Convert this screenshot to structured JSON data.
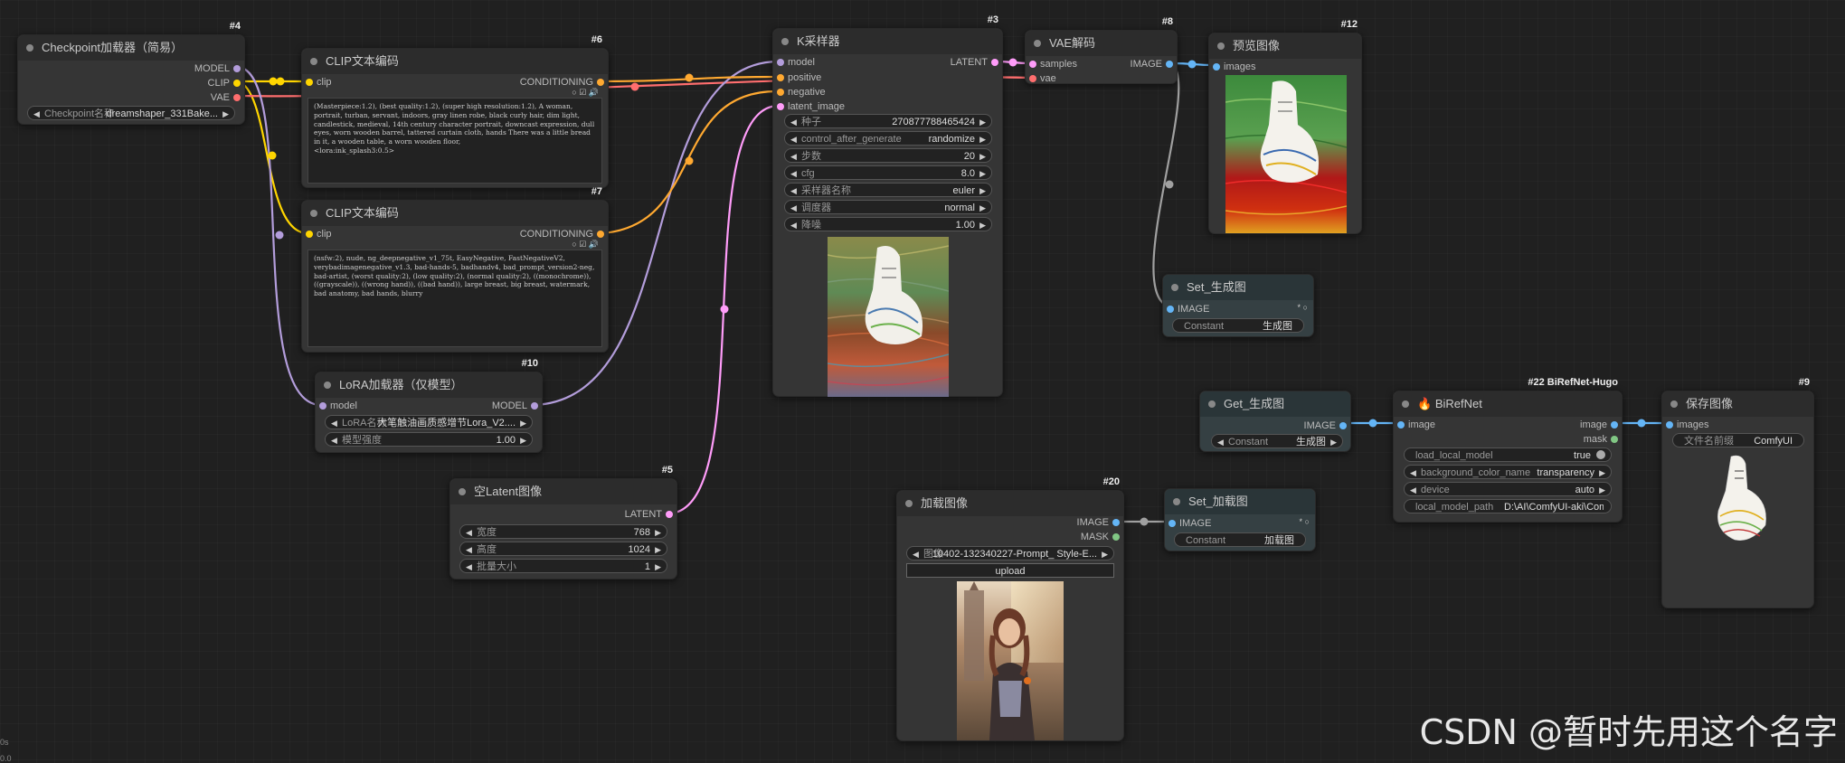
{
  "nodes": {
    "n4": {
      "id": "#4",
      "title": "Checkpoint加载器（简易）",
      "outputs": [
        "MODEL",
        "CLIP",
        "VAE"
      ],
      "widget_label": "Checkpoint名称",
      "widget_value": "dreamshaper_331Bake..."
    },
    "n6": {
      "id": "#6",
      "title": "CLIP文本编码",
      "input": "clip",
      "output": "CONDITIONING",
      "text": "(Masterpiece:1.2), (best quality:1.2), (super high resolution:1.2), A woman, portrait, turban, servant, indoors, gray linen robe, black curly hair, dim light, candlestick, medieval, 14th century character portrait, downcast expression, dull eyes, worn wooden barrel, tattered curtain cloth, hands There was a little bread in it, a wooden table, a worn wooden floor,\n<lora:ink_splash3:0.5>"
    },
    "n7": {
      "id": "#7",
      "title": "CLIP文本编码",
      "input": "clip",
      "output": "CONDITIONING",
      "text": "(nsfw:2), nude, ng_deepnegative_v1_75t, EasyNegative, FastNegativeV2, verybadimagenegative_v1.3, bad-hands-5, badhandv4, bad_prompt_version2-neg, bad-artist, (worst quality:2), (low quality:2), (normal quality:2), ((monochrome)), ((grayscale)), ((wrong hand)), ((bad hand)), large breast, big breast, watermark, bad anatomy, bad hands, blurry"
    },
    "n10": {
      "id": "#10",
      "title": "LoRA加载器（仅模型）",
      "input": "model",
      "output": "MODEL",
      "w1_label": "LoRA名称",
      "w1_value": "大笔触油画质感增节Lora_V2....",
      "w2_label": "模型强度",
      "w2_value": "1.00"
    },
    "n5": {
      "id": "#5",
      "title": "空Latent图像",
      "output": "LATENT",
      "w1_label": "宽度",
      "w1_value": "768",
      "w2_label": "高度",
      "w2_value": "1024",
      "w3_label": "批量大小",
      "w3_value": "1"
    },
    "n3": {
      "id": "#3",
      "title": "K采样器",
      "inputs": [
        "model",
        "positive",
        "negative",
        "latent_image"
      ],
      "output": "LATENT",
      "widgets": [
        {
          "label": "种子",
          "value": "270877788465424"
        },
        {
          "label": "control_after_generate",
          "value": "randomize"
        },
        {
          "label": "步数",
          "value": "20"
        },
        {
          "label": "cfg",
          "value": "8.0"
        },
        {
          "label": "采样器名称",
          "value": "euler"
        },
        {
          "label": "调度器",
          "value": "normal"
        },
        {
          "label": "降噪",
          "value": "1.00"
        }
      ]
    },
    "n8": {
      "id": "#8",
      "title": "VAE解码",
      "inputs": [
        "samples",
        "vae"
      ],
      "output": "IMAGE"
    },
    "n12": {
      "id": "#12",
      "title": "预览图像",
      "input": "images"
    },
    "set1": {
      "title": "Set_生成图",
      "input": "IMAGE",
      "w_label": "Constant",
      "w_value": "生成图"
    },
    "get1": {
      "title": "Get_生成图",
      "output": "IMAGE",
      "w_label": "Constant",
      "w_value": "生成图"
    },
    "n22": {
      "id": "#22 BiRefNet-Hugo",
      "title": "BiRefNet",
      "input": "image",
      "outputs": [
        "image",
        "mask"
      ],
      "widgets": [
        {
          "label": "load_local_model",
          "value": "true"
        },
        {
          "label": "background_color_name",
          "value": "transparency"
        },
        {
          "label": "device",
          "value": "auto"
        },
        {
          "label": "local_model_path",
          "value": "D:\\AI\\ComfyUI-aki\\ComfyUI-aki-"
        }
      ]
    },
    "n9": {
      "id": "#9",
      "title": "保存图像",
      "input": "images",
      "w_label": "文件名前缀",
      "w_value": "ComfyUI"
    },
    "n20": {
      "id": "#20",
      "title": "加载图像",
      "outputs": [
        "IMAGE",
        "MASK"
      ],
      "w_label": "图像",
      "w_value": "10402-132340227-Prompt_ Style-E...",
      "upload": "upload"
    },
    "set2": {
      "title": "Set_加载图",
      "input": "IMAGE",
      "w_label": "Constant",
      "w_value": "加载图"
    }
  },
  "colors": {
    "model": "#b39ddb",
    "clip": "#ffd500",
    "vae": "#ff6e6e",
    "conditioning": "#ffa931",
    "latent": "#ff9cf9",
    "image": "#64b5f6",
    "mask": "#81c784",
    "gray": "#a0a0a0"
  },
  "watermark": "CSDN @暂时先用这个名字",
  "corner": [
    "0s",
    "0.0"
  ]
}
